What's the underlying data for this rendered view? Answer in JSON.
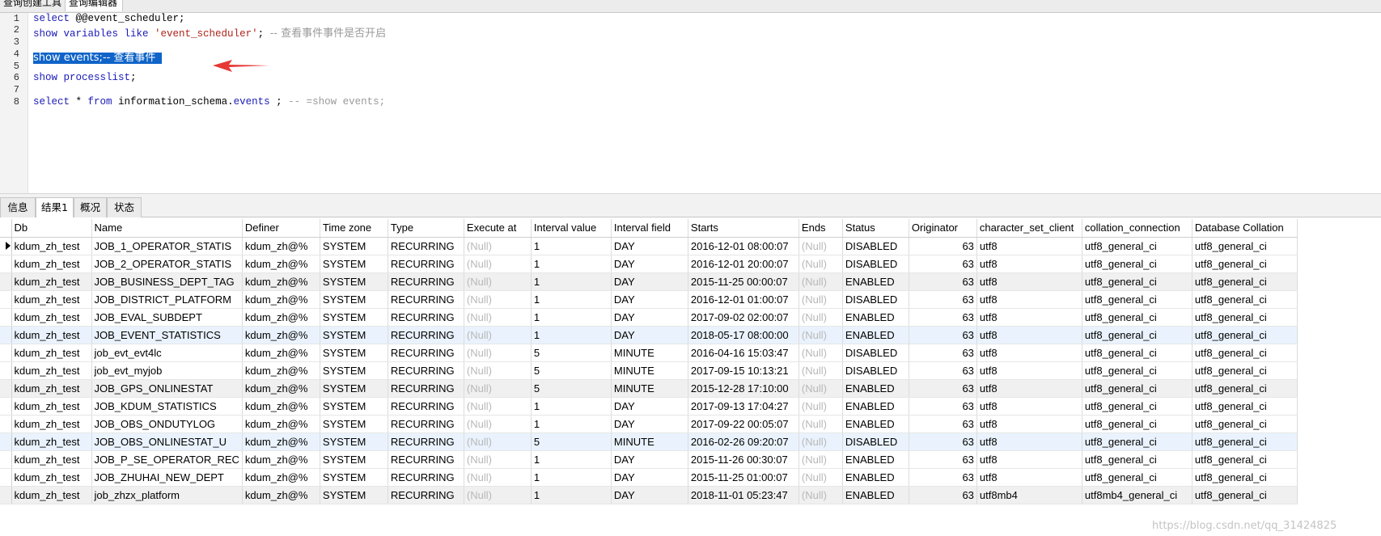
{
  "top_tabs": [
    "查询创建工具",
    "查询编辑器"
  ],
  "editor": {
    "line_numbers": [
      "1",
      "2",
      "3",
      "4",
      "5",
      "6",
      "7",
      "8"
    ],
    "line1": {
      "kw": "select",
      "rest": " @@event_scheduler;"
    },
    "line2": {
      "kw1": "show",
      "kw2": " variables like ",
      "str": "'event_scheduler'",
      "semi": "; ",
      "comment": "-- 查看事件事件是否开启"
    },
    "line4": {
      "selected": "show events;-- 查看事件"
    },
    "line6": {
      "kw": "show processlist",
      "rest": ";"
    },
    "line8": {
      "kw1": "select",
      "mid1": " * ",
      "kw2": "from",
      "mid2": " information_schema.",
      "kw3": "events",
      "mid3": " ; ",
      "comment": "-- =show events;"
    }
  },
  "annotation": {
    "arrow_color": "#e53935"
  },
  "result_tabs": [
    "信息",
    "结果1",
    "概况",
    "状态"
  ],
  "active_result_tab": "结果1",
  "grid": {
    "columns": [
      "Db",
      "Name",
      "Definer",
      "Time zone",
      "Type",
      "Execute at",
      "Interval value",
      "Interval field",
      "Starts",
      "Ends",
      "Status",
      "Originator",
      "character_set_client",
      "collation_connection",
      "Database Collation"
    ],
    "rows": [
      [
        "kdum_zh_test",
        "JOB_1_OPERATOR_STATIS",
        "kdum_zh@%",
        "SYSTEM",
        "RECURRING",
        "(Null)",
        "1",
        "DAY",
        "2016-12-01 08:00:07",
        "(Null)",
        "DISABLED",
        "63",
        "utf8",
        "utf8_general_ci",
        "utf8_general_ci"
      ],
      [
        "kdum_zh_test",
        "JOB_2_OPERATOR_STATIS",
        "kdum_zh@%",
        "SYSTEM",
        "RECURRING",
        "(Null)",
        "1",
        "DAY",
        "2016-12-01 20:00:07",
        "(Null)",
        "DISABLED",
        "63",
        "utf8",
        "utf8_general_ci",
        "utf8_general_ci"
      ],
      [
        "kdum_zh_test",
        "JOB_BUSINESS_DEPT_TAG",
        "kdum_zh@%",
        "SYSTEM",
        "RECURRING",
        "(Null)",
        "1",
        "DAY",
        "2015-11-25 00:00:07",
        "(Null)",
        "ENABLED",
        "63",
        "utf8",
        "utf8_general_ci",
        "utf8_general_ci"
      ],
      [
        "kdum_zh_test",
        "JOB_DISTRICT_PLATFORM",
        "kdum_zh@%",
        "SYSTEM",
        "RECURRING",
        "(Null)",
        "1",
        "DAY",
        "2016-12-01 01:00:07",
        "(Null)",
        "DISABLED",
        "63",
        "utf8",
        "utf8_general_ci",
        "utf8_general_ci"
      ],
      [
        "kdum_zh_test",
        "JOB_EVAL_SUBDEPT",
        "kdum_zh@%",
        "SYSTEM",
        "RECURRING",
        "(Null)",
        "1",
        "DAY",
        "2017-09-02 02:00:07",
        "(Null)",
        "ENABLED",
        "63",
        "utf8",
        "utf8_general_ci",
        "utf8_general_ci"
      ],
      [
        "kdum_zh_test",
        "JOB_EVENT_STATISTICS",
        "kdum_zh@%",
        "SYSTEM",
        "RECURRING",
        "(Null)",
        "1",
        "DAY",
        "2018-05-17 08:00:00",
        "(Null)",
        "ENABLED",
        "63",
        "utf8",
        "utf8_general_ci",
        "utf8_general_ci"
      ],
      [
        "kdum_zh_test",
        "job_evt_evt4lc",
        "kdum_zh@%",
        "SYSTEM",
        "RECURRING",
        "(Null)",
        "5",
        "MINUTE",
        "2016-04-16 15:03:47",
        "(Null)",
        "DISABLED",
        "63",
        "utf8",
        "utf8_general_ci",
        "utf8_general_ci"
      ],
      [
        "kdum_zh_test",
        "job_evt_myjob",
        "kdum_zh@%",
        "SYSTEM",
        "RECURRING",
        "(Null)",
        "5",
        "MINUTE",
        "2017-09-15 10:13:21",
        "(Null)",
        "DISABLED",
        "63",
        "utf8",
        "utf8_general_ci",
        "utf8_general_ci"
      ],
      [
        "kdum_zh_test",
        "JOB_GPS_ONLINESTAT",
        "kdum_zh@%",
        "SYSTEM",
        "RECURRING",
        "(Null)",
        "5",
        "MINUTE",
        "2015-12-28 17:10:00",
        "(Null)",
        "ENABLED",
        "63",
        "utf8",
        "utf8_general_ci",
        "utf8_general_ci"
      ],
      [
        "kdum_zh_test",
        "JOB_KDUM_STATISTICS",
        "kdum_zh@%",
        "SYSTEM",
        "RECURRING",
        "(Null)",
        "1",
        "DAY",
        "2017-09-13 17:04:27",
        "(Null)",
        "ENABLED",
        "63",
        "utf8",
        "utf8_general_ci",
        "utf8_general_ci"
      ],
      [
        "kdum_zh_test",
        "JOB_OBS_ONDUTYLOG",
        "kdum_zh@%",
        "SYSTEM",
        "RECURRING",
        "(Null)",
        "1",
        "DAY",
        "2017-09-22 00:05:07",
        "(Null)",
        "ENABLED",
        "63",
        "utf8",
        "utf8_general_ci",
        "utf8_general_ci"
      ],
      [
        "kdum_zh_test",
        "JOB_OBS_ONLINESTAT_U",
        "kdum_zh@%",
        "SYSTEM",
        "RECURRING",
        "(Null)",
        "5",
        "MINUTE",
        "2016-02-26 09:20:07",
        "(Null)",
        "DISABLED",
        "63",
        "utf8",
        "utf8_general_ci",
        "utf8_general_ci"
      ],
      [
        "kdum_zh_test",
        "JOB_P_SE_OPERATOR_REC",
        "kdum_zh@%",
        "SYSTEM",
        "RECURRING",
        "(Null)",
        "1",
        "DAY",
        "2015-11-26 00:30:07",
        "(Null)",
        "ENABLED",
        "63",
        "utf8",
        "utf8_general_ci",
        "utf8_general_ci"
      ],
      [
        "kdum_zh_test",
        "JOB_ZHUHAI_NEW_DEPT",
        "kdum_zh@%",
        "SYSTEM",
        "RECURRING",
        "(Null)",
        "1",
        "DAY",
        "2015-11-25 01:00:07",
        "(Null)",
        "ENABLED",
        "63",
        "utf8",
        "utf8_general_ci",
        "utf8_general_ci"
      ],
      [
        "kdum_zh_test",
        "job_zhzx_platform",
        "kdum_zh@%",
        "SYSTEM",
        "RECURRING",
        "(Null)",
        "1",
        "DAY",
        "2018-11-01 05:23:47",
        "(Null)",
        "ENABLED",
        "63",
        "utf8mb4",
        "utf8mb4_general_ci",
        "utf8_general_ci"
      ]
    ]
  },
  "watermark": "https://blog.csdn.net/qq_31424825"
}
